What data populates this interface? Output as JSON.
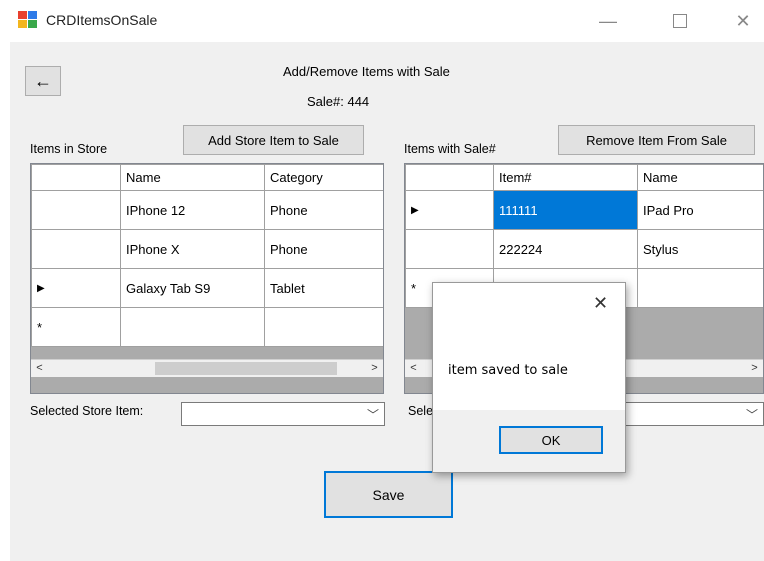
{
  "window": {
    "title": "CRDItemsOnSale"
  },
  "header": {
    "heading": "Add/Remove Items with Sale",
    "sale_label": "Sale#: 444",
    "back_glyph": "←"
  },
  "store": {
    "label": "Items in Store",
    "add_button": "Add Store Item to Sale",
    "columns": [
      "Name",
      "Category"
    ],
    "rows": [
      {
        "indicator": "",
        "name": "IPhone 12",
        "category": "Phone"
      },
      {
        "indicator": "",
        "name": "IPhone X",
        "category": "Phone"
      },
      {
        "indicator": "▶",
        "name": "Galaxy Tab S9",
        "category": "Tablet"
      },
      {
        "indicator": "*",
        "name": "",
        "category": ""
      }
    ],
    "selected_label": "Selected Store Item:",
    "selected_value": ""
  },
  "sale": {
    "label": "Items with Sale#",
    "remove_button": "Remove Item From Sale",
    "columns": [
      "Item#",
      "Name"
    ],
    "rows": [
      {
        "indicator": "▶",
        "item": "111111",
        "name": "IPad Pro"
      },
      {
        "indicator": "",
        "item": "222224",
        "name": "Stylus"
      },
      {
        "indicator": "*",
        "item": "",
        "name": ""
      }
    ],
    "selected_label_visible": "Sele",
    "selected_value": ""
  },
  "save_button": "Save",
  "dialog": {
    "message": "item saved to sale",
    "ok_label": "OK"
  },
  "colors": {
    "accent": "#0078d7",
    "window_bg": "#f0f0f0",
    "grid_empty": "#ababab"
  }
}
